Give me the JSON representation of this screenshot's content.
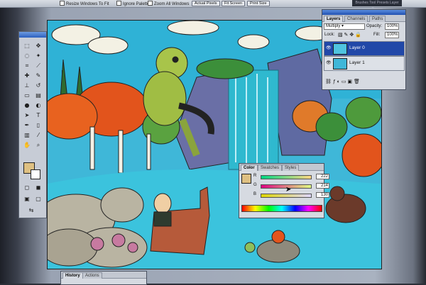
{
  "options_bar": {
    "resize_windows": "Resize Windows To Fit",
    "ignore_palettes": "Ignore Palettes",
    "zoom_all_windows": "Zoom All Windows",
    "actual_pixels": "Actual Pixels",
    "fit_screen": "Fit Screen",
    "print_size": "Print Size",
    "top_right": "Brushes Tool Presets Layer Comps"
  },
  "layers_panel": {
    "tabs": [
      "Layers",
      "Channels",
      "Paths"
    ],
    "blend_mode": "Multiply",
    "opacity_label": "Opacity:",
    "opacity_value": "100%",
    "lock_label": "Lock:",
    "fill_label": "Fill:",
    "fill_value": "100%",
    "layers": [
      {
        "name": "Layer 0",
        "selected": true
      },
      {
        "name": "Layer 1",
        "selected": false
      }
    ]
  },
  "color_panel": {
    "tabs": [
      "Color",
      "Swatches",
      "Styles"
    ],
    "channels": [
      {
        "label": "R",
        "value": "222"
      },
      {
        "label": "G",
        "value": "214"
      },
      {
        "label": "B",
        "value": "130"
      }
    ],
    "foreground_color": "#dec082"
  },
  "history_panel": {
    "tabs": [
      "History",
      "Actions"
    ]
  },
  "colors": {
    "panel_title": "#2b5fbf",
    "selected_layer": "#2148a8",
    "water": "#3fb7d8",
    "foliage_orange": "#e2541c"
  }
}
